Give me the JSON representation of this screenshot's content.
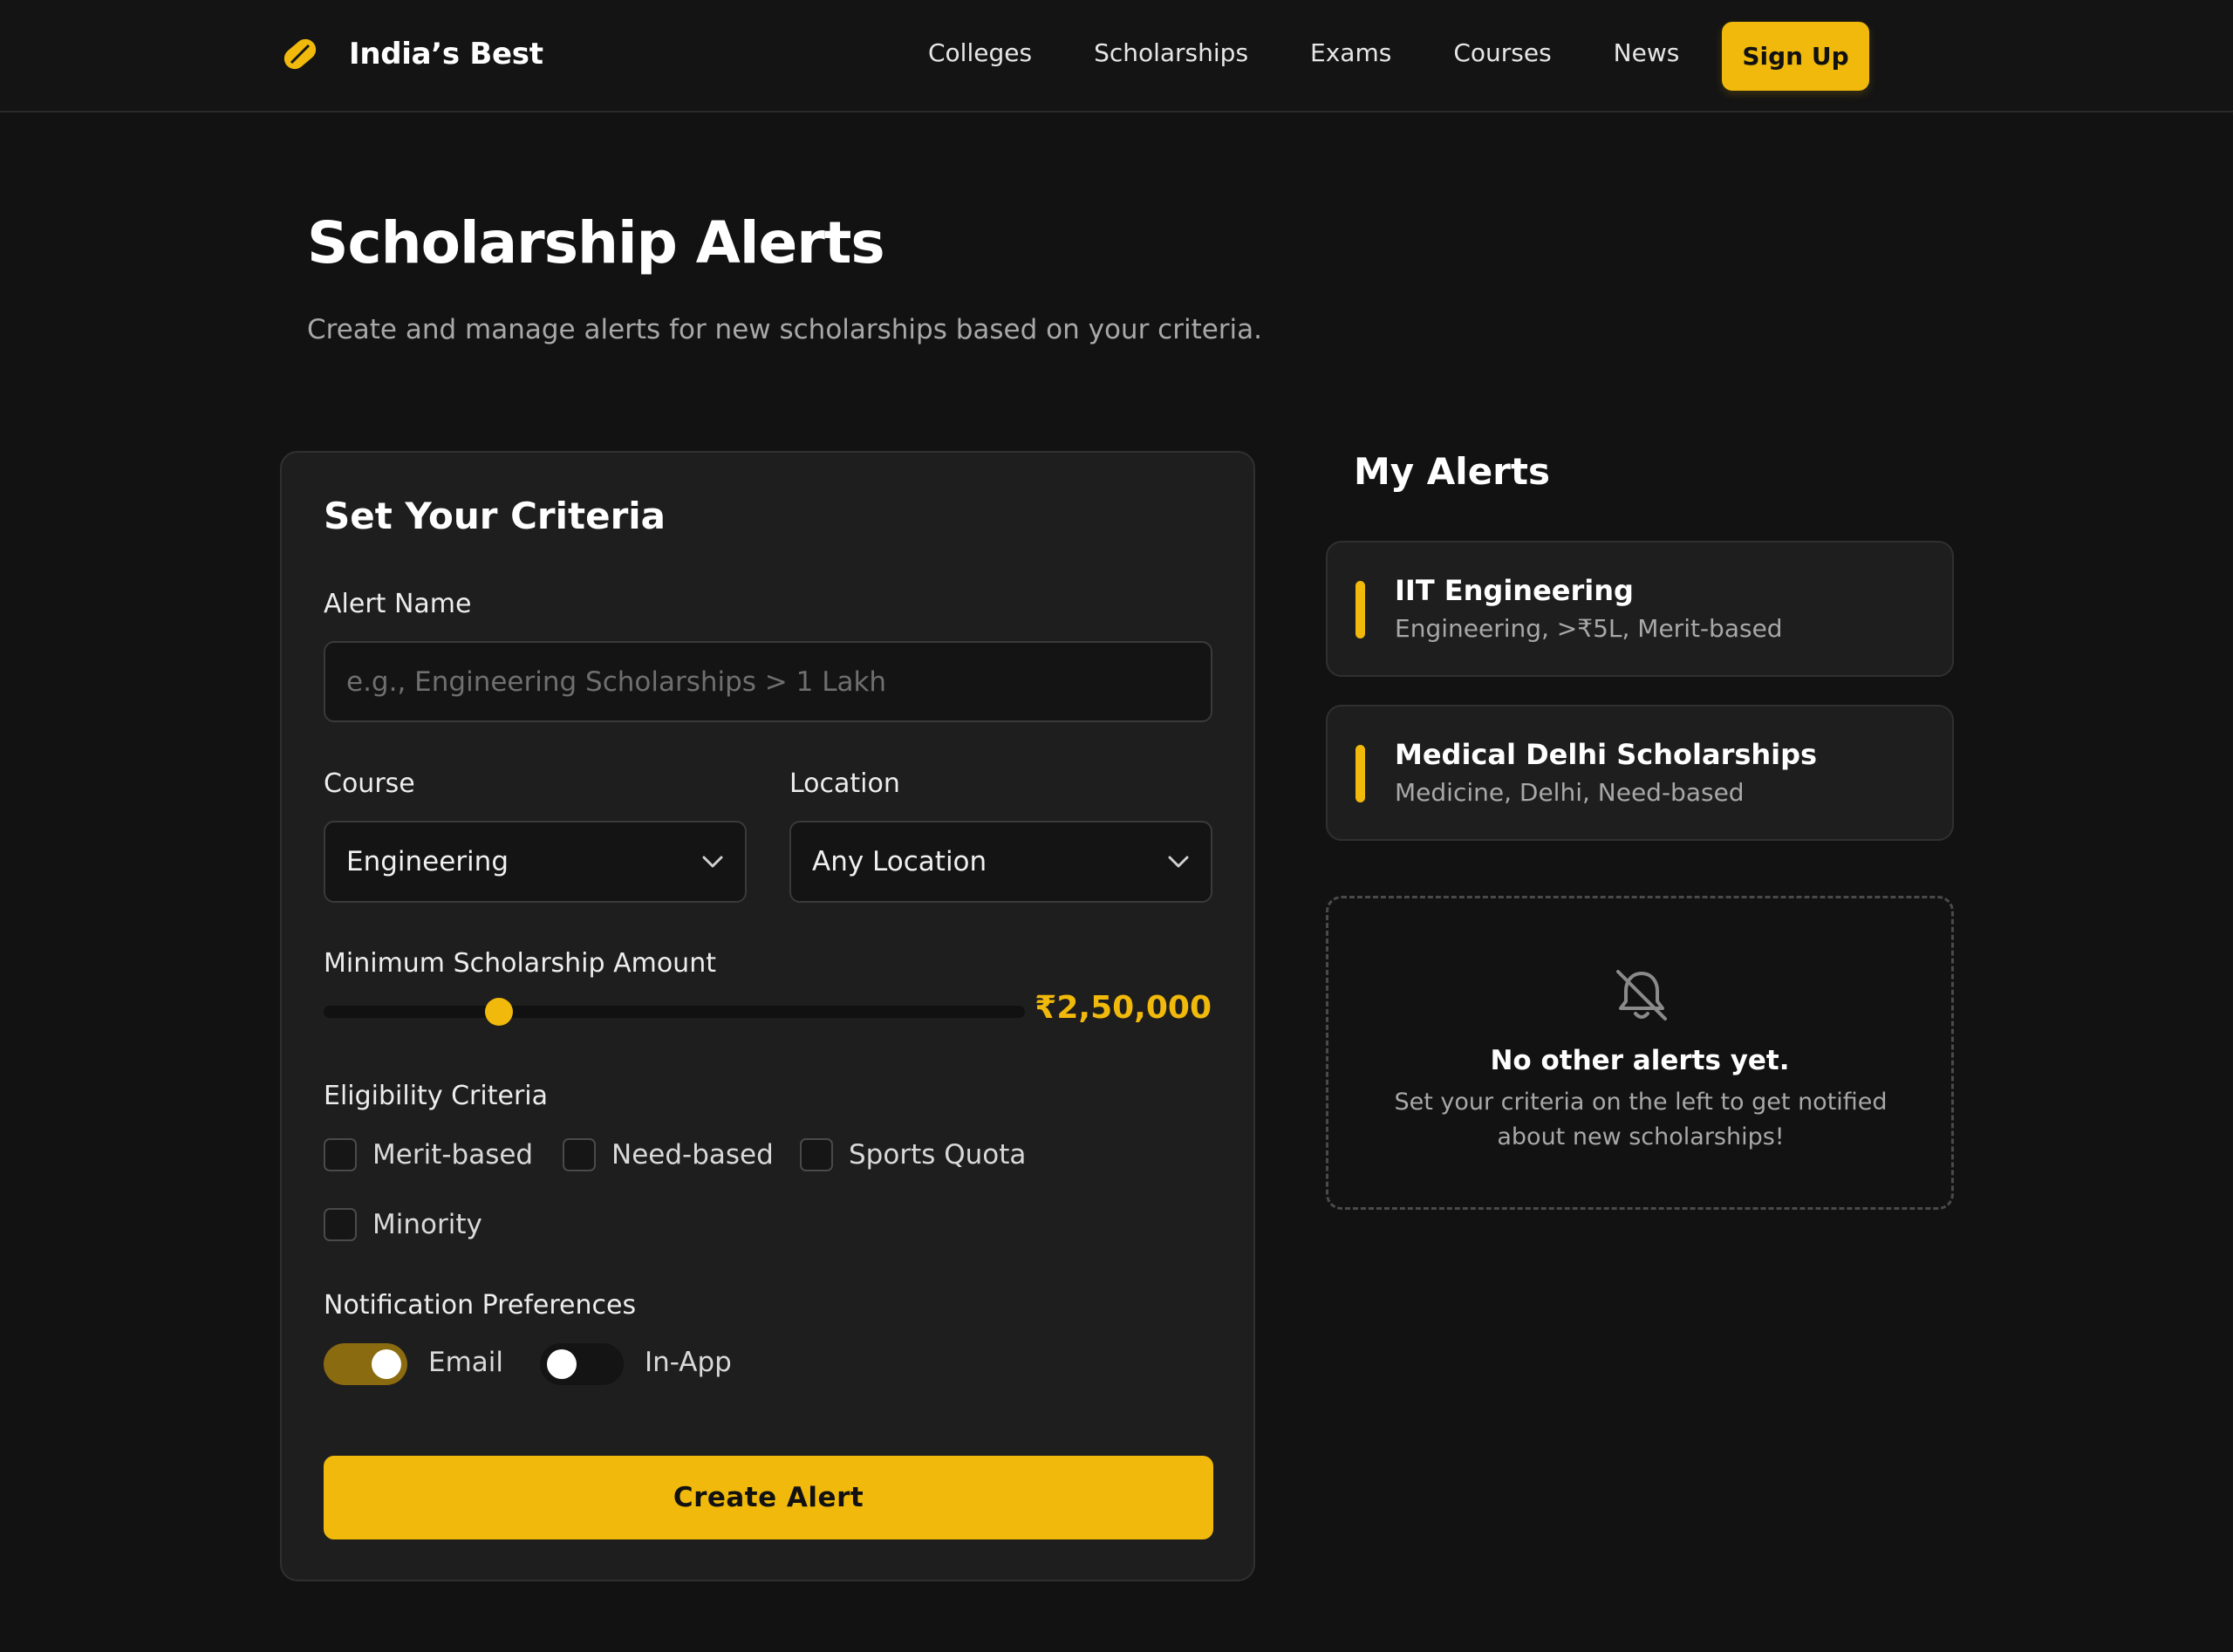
{
  "header": {
    "brand": "India’s Best",
    "nav": [
      "Colleges",
      "Scholarships",
      "Exams",
      "Courses",
      "News"
    ],
    "signup_label": "Sign Up"
  },
  "page": {
    "title": "Scholarship Alerts",
    "subtitle": "Create and manage alerts for new scholarships based on your criteria."
  },
  "criteria": {
    "title": "Set Your Criteria",
    "alert_name_label": "Alert Name",
    "alert_name_placeholder": "e.g., Engineering Scholarships > 1 Lakh",
    "alert_name_value": "",
    "course_label": "Course",
    "course_value": "Engineering",
    "location_label": "Location",
    "location_value": "Any Location",
    "amount_label": "Minimum Scholarship Amount",
    "amount_value": "₹2,50,000",
    "amount_fraction": 0.25,
    "eligibility_label": "Eligibility Criteria",
    "eligibility": [
      {
        "label": "Merit-based",
        "checked": false
      },
      {
        "label": "Need-based",
        "checked": false
      },
      {
        "label": "Sports Quota",
        "checked": false
      },
      {
        "label": "Minority",
        "checked": false
      }
    ],
    "notify_label": "Notification Preferences",
    "notify": [
      {
        "label": "Email",
        "on": true
      },
      {
        "label": "In-App",
        "on": false
      }
    ],
    "create_label": "Create Alert"
  },
  "alerts": {
    "title": "My Alerts",
    "items": [
      {
        "name": "IIT Engineering",
        "desc": "Engineering, >₹5L, Merit-based"
      },
      {
        "name": "Medical Delhi Scholarships",
        "desc": "Medicine, Delhi, Need-based"
      }
    ],
    "empty_title": "No other alerts yet.",
    "empty_text": "Set your criteria on the left to get notified about new scholarships!"
  },
  "colors": {
    "accent": "#f0b90b",
    "background": "#121212",
    "card": "#1e1e1e"
  },
  "icons": {
    "brand": "tag-icon",
    "select": "chevron-down-icon",
    "empty": "bell-off-icon"
  }
}
